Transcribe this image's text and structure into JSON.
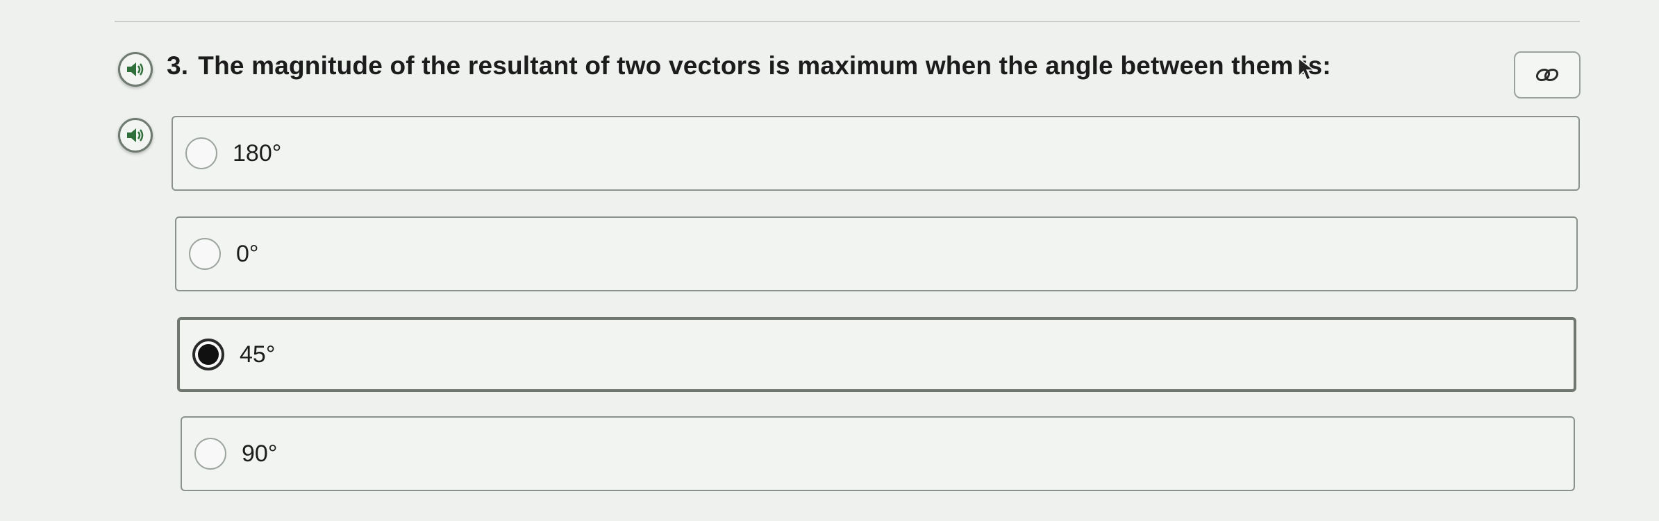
{
  "question": {
    "number": "3.",
    "text": "The magnitude of the resultant of two vectors is maximum when the angle between them is:"
  },
  "icons": {
    "question_audio": "speaker-icon",
    "option_audio": "speaker-icon",
    "link": "link-icon",
    "cursor": "mouse-pointer-icon"
  },
  "options": [
    {
      "label": "180°",
      "selected": false
    },
    {
      "label": "0°",
      "selected": false
    },
    {
      "label": "45°",
      "selected": true
    },
    {
      "label": "90°",
      "selected": false
    }
  ]
}
